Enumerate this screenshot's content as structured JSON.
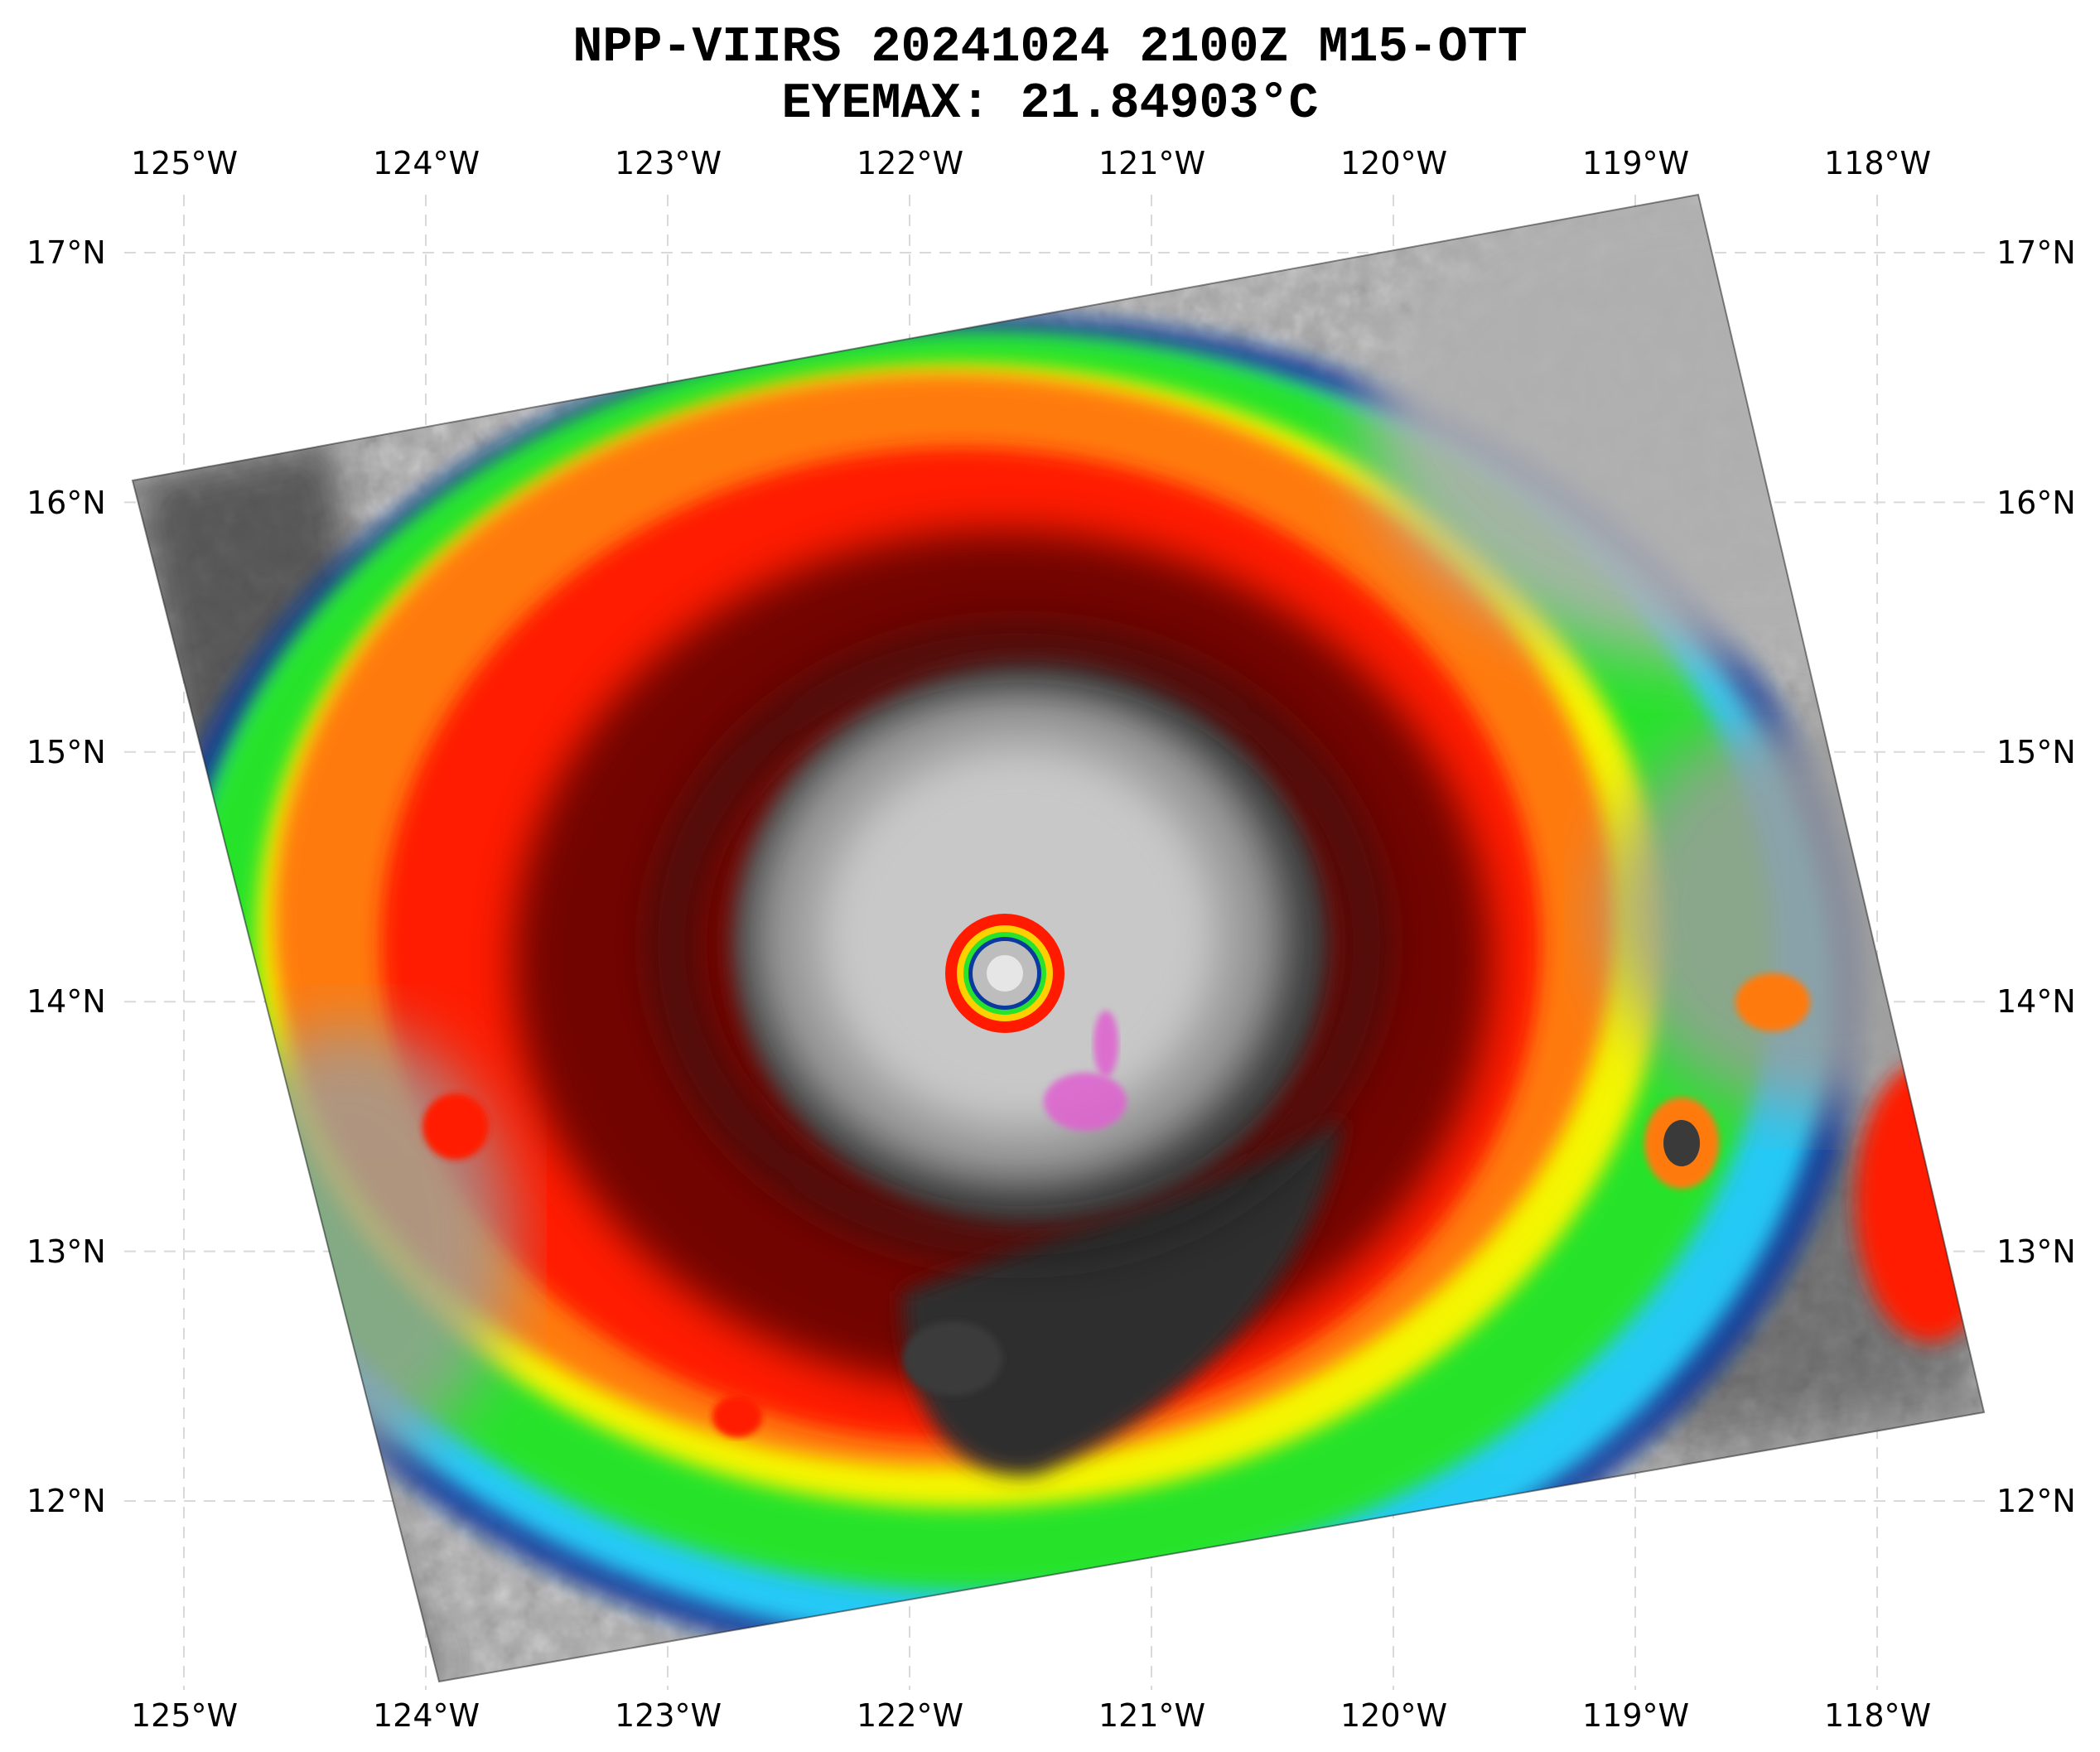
{
  "title": {
    "line1": "NPP-VIIRS 20241024 2100Z M15-OTT",
    "line2": "EYEMAX: 21.84903°C"
  },
  "axes": {
    "lon_labels": [
      "125°W",
      "124°W",
      "123°W",
      "122°W",
      "121°W",
      "120°W",
      "119°W",
      "118°W"
    ],
    "lon_values": [
      -125,
      -124,
      -123,
      -122,
      -121,
      -120,
      -119,
      -118
    ],
    "lat_labels": [
      "17°N",
      "16°N",
      "15°N",
      "14°N",
      "13°N",
      "12°N"
    ],
    "lat_values": [
      17,
      16,
      15,
      14,
      13,
      12
    ],
    "gridlines": true,
    "grid_style": "dashed light gray"
  },
  "imagery": {
    "type": "infrared satellite swath, tropical cyclone",
    "eye_center_lon": -121.8,
    "eye_center_lat": 14.1,
    "colors": {
      "warm_gray": "#bdbdbd",
      "dark_gray": "#3a3a3a",
      "blue": "#0a3aa0",
      "cyan": "#25d8ff",
      "green": "#27e32c",
      "yellow": "#f4f500",
      "orange": "#ff7a10",
      "red": "#ff1a00",
      "dark_red": "#5a0000",
      "magenta": "#e060d0"
    }
  }
}
